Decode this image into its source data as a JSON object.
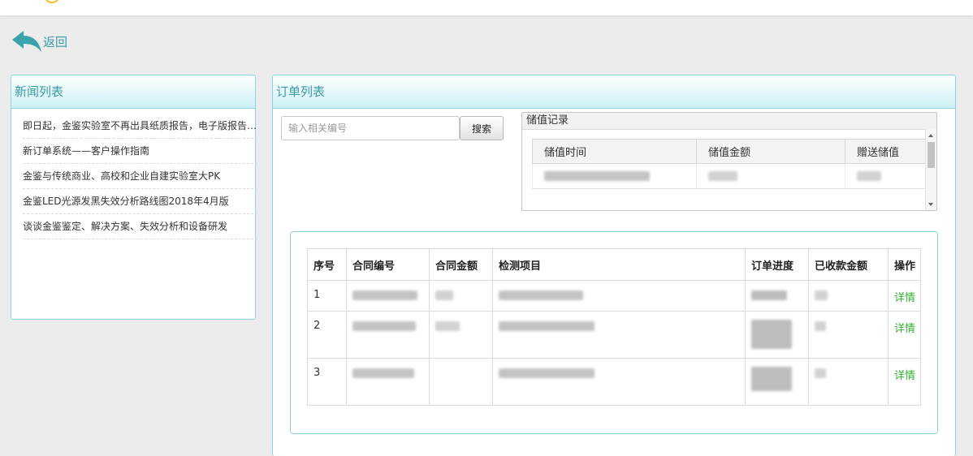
{
  "back": {
    "label": "返回"
  },
  "news": {
    "title": "新闻列表",
    "items": [
      "即日起，金鉴实验室不再出具纸质报告，电子版报告同样具有法律效力",
      "新订单系统——客户操作指南",
      "金鉴与传统商业、高校和企业自建实验室大PK",
      "金鉴LED光源发黑失效分析路线图2018年4月版",
      "谈谈金鉴鉴定、解决方案、失效分析和设备研发"
    ]
  },
  "orders": {
    "title": "订单列表",
    "search": {
      "placeholder": "输入相关编号",
      "button": "搜索"
    },
    "deposit": {
      "title": "储值记录",
      "columns": [
        "储值时间",
        "储值金额",
        "赠送储值"
      ]
    },
    "table": {
      "columns": [
        "序号",
        "合同编号",
        "合同金额",
        "检测项目",
        "订单进度",
        "已收款金额",
        "操作"
      ],
      "rows": [
        {
          "index": "1",
          "action": "详情"
        },
        {
          "index": "2",
          "action": "详情"
        },
        {
          "index": "3",
          "action": "详情"
        }
      ]
    }
  },
  "colors": {
    "accent": "#3a9aa5",
    "panel_border": "#8ed4de",
    "header_gradient_end": "#cbf1f6",
    "link_green": "#33b233",
    "logo_gold": "#f3c22a"
  },
  "icons": {
    "back": "back-arrow-icon",
    "scroll_up": "scroll-up-arrow-icon",
    "scroll_down": "scroll-down-arrow-icon"
  }
}
